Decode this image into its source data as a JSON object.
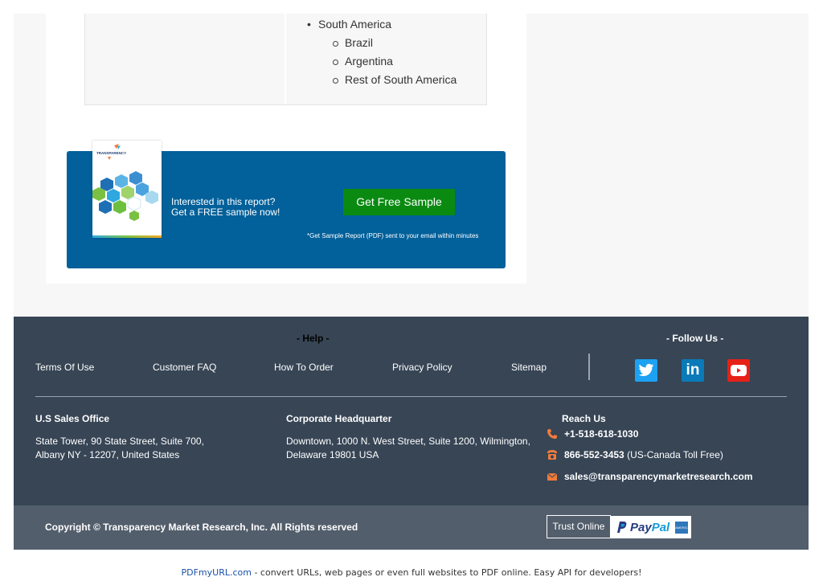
{
  "regions": {
    "parent": "South America",
    "children": [
      "Brazil",
      "Argentina",
      "Rest of South America"
    ]
  },
  "banner": {
    "line1": "Interested in this report?",
    "line2": "Get a FREE sample now!",
    "button": "Get Free Sample",
    "note": "*Get Sample Report (PDF) sent to your email within minutes",
    "cover_logo_text": "TRANSPARENCY"
  },
  "footer": {
    "help_heading": "- Help -",
    "follow_heading": "- Follow Us -",
    "links": [
      "Terms Of Use",
      "Customer FAQ",
      "How To Order",
      "Privacy Policy",
      "Sitemap"
    ],
    "social": [
      {
        "name": "twitter",
        "color": "#1da1f2",
        "icon": "twitter-icon"
      },
      {
        "name": "linkedin",
        "color": "#0a7ab8",
        "icon": "linkedin-icon",
        "glyph": "in"
      },
      {
        "name": "youtube",
        "color": "#e62117",
        "icon": "youtube-icon"
      }
    ],
    "us_office": {
      "title": "U.S Sales Office",
      "line1": "State Tower, 90 State Street, Suite 700,",
      "line2": "Albany NY - 12207, United States"
    },
    "hq": {
      "title": "Corporate Headquarter",
      "line1": "Downtown, 1000 N. West Street, Suite 1200, Wilmington,",
      "line2": "Delaware 19801 USA"
    },
    "reach": {
      "title": "Reach Us",
      "phone1": "+1-518-618-1030",
      "phone2": "866-552-3453",
      "phone2_note": " (US-Canada Toll Free)",
      "email": "sales@transparencymarketresearch.com"
    },
    "accent_color": "#f07b3a"
  },
  "bottom": {
    "copyright": "Copyright © Transparency Market Research, Inc. All Rights reserved",
    "trust": "Trust Online",
    "paypal_1": "Pay",
    "paypal_2": "Pal",
    "amex": "AMERICAN EXPRESS"
  },
  "credit": {
    "link": "PDFmyURL.com",
    "text": " - convert URLs, web pages or even full websites to PDF online. Easy API for developers!"
  }
}
